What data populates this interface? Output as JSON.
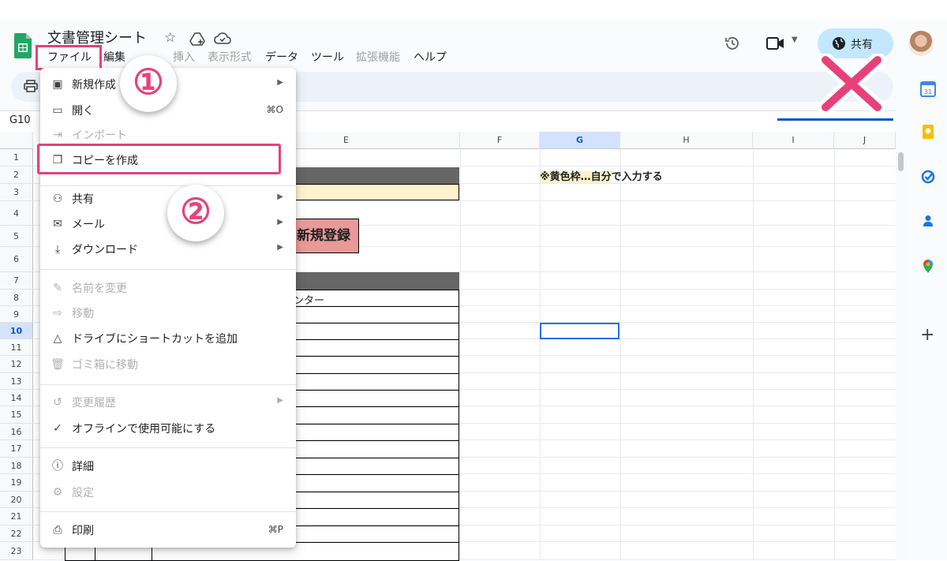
{
  "document": {
    "title": "文書管理シート"
  },
  "menubar": [
    "ファイル",
    "編集",
    "挿入",
    "表示形式",
    "データ",
    "ツール",
    "拡張機能",
    "ヘルプ"
  ],
  "share": {
    "label": "共有"
  },
  "name_box": "G10",
  "columns": [
    "E",
    "F",
    "G",
    "H",
    "I",
    "J"
  ],
  "selected_column": "G",
  "rows": [
    "1",
    "2",
    "3",
    "4",
    "5",
    "6",
    "7",
    "8",
    "9",
    "10",
    "11",
    "12",
    "13",
    "14",
    "15",
    "16",
    "17",
    "18",
    "19",
    "20",
    "21",
    "22",
    "23"
  ],
  "selected_row": "10",
  "sheet": {
    "note": {
      "highlight": "※黄色枠…自分",
      "rest": "で入力する"
    },
    "new_register_button": "新規登録",
    "center_header_fragment": "ンター"
  },
  "file_menu": {
    "items": [
      {
        "label": "新規作成",
        "icon": "new-icon",
        "submenu": true,
        "enabled": true
      },
      {
        "label": "開く",
        "icon": "folder-icon",
        "shortcut": "⌘O",
        "enabled": true
      },
      {
        "label": "インポート",
        "icon": "import-icon",
        "enabled": false
      },
      {
        "label": "コピーを作成",
        "icon": "copy-icon",
        "enabled": true
      },
      {
        "label": "共有",
        "icon": "share-icon",
        "submenu": true,
        "enabled": true
      },
      {
        "label": "メール",
        "icon": "mail-icon",
        "submenu": true,
        "enabled": true
      },
      {
        "label": "ダウンロード",
        "icon": "download-icon",
        "submenu": true,
        "enabled": true
      },
      {
        "label": "名前を変更",
        "icon": "rename-icon",
        "enabled": false
      },
      {
        "label": "移動",
        "icon": "move-icon",
        "enabled": false
      },
      {
        "label": "ドライブにショートカットを追加",
        "icon": "drive-shortcut-icon",
        "enabled": true
      },
      {
        "label": "ゴミ箱に移動",
        "icon": "trash-icon",
        "enabled": false
      },
      {
        "label": "変更履歴",
        "icon": "history-icon",
        "submenu": true,
        "enabled": false
      },
      {
        "label": "オフラインで使用可能にする",
        "icon": "offline-icon",
        "enabled": true
      },
      {
        "label": "詳細",
        "icon": "info-icon",
        "enabled": true
      },
      {
        "label": "設定",
        "icon": "settings-icon",
        "enabled": false
      },
      {
        "label": "印刷",
        "icon": "print-icon",
        "shortcut": "⌘P",
        "enabled": true
      }
    ]
  },
  "annotations": {
    "step1": "①",
    "step2": "②"
  },
  "colors": {
    "highlight": "#e8417a",
    "share_bg": "#c2e7ff",
    "yellow_cell": "#fff2cc",
    "button_red": "#ea9999"
  }
}
